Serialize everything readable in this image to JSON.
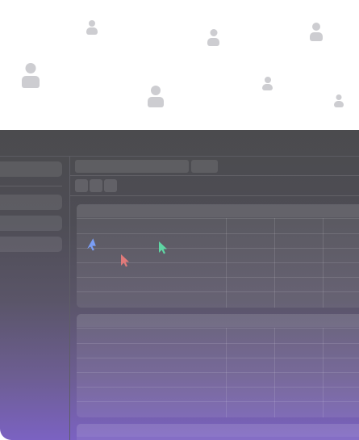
{
  "avatars": [
    {
      "id": "u1"
    },
    {
      "id": "u2"
    },
    {
      "id": "u3"
    },
    {
      "id": "u4"
    },
    {
      "id": "u5"
    },
    {
      "id": "u6"
    },
    {
      "id": "u7"
    },
    {
      "id": "u8"
    }
  ],
  "colors": {
    "avatar": "#cdcdd1",
    "app_top": "#4b4b4e",
    "app_bottom": "#7b62c2",
    "cursor_blue": "#7a9ef5",
    "cursor_red": "#e07a7a",
    "cursor_green": "#5fd6a4"
  },
  "cursors": [
    {
      "name": "collaborator-cursor-blue-icon",
      "color": "#7a9ef5"
    },
    {
      "name": "collaborator-cursor-red-icon",
      "color": "#e07a7a"
    },
    {
      "name": "collaborator-cursor-green-icon",
      "color": "#5fd6a4"
    }
  ]
}
